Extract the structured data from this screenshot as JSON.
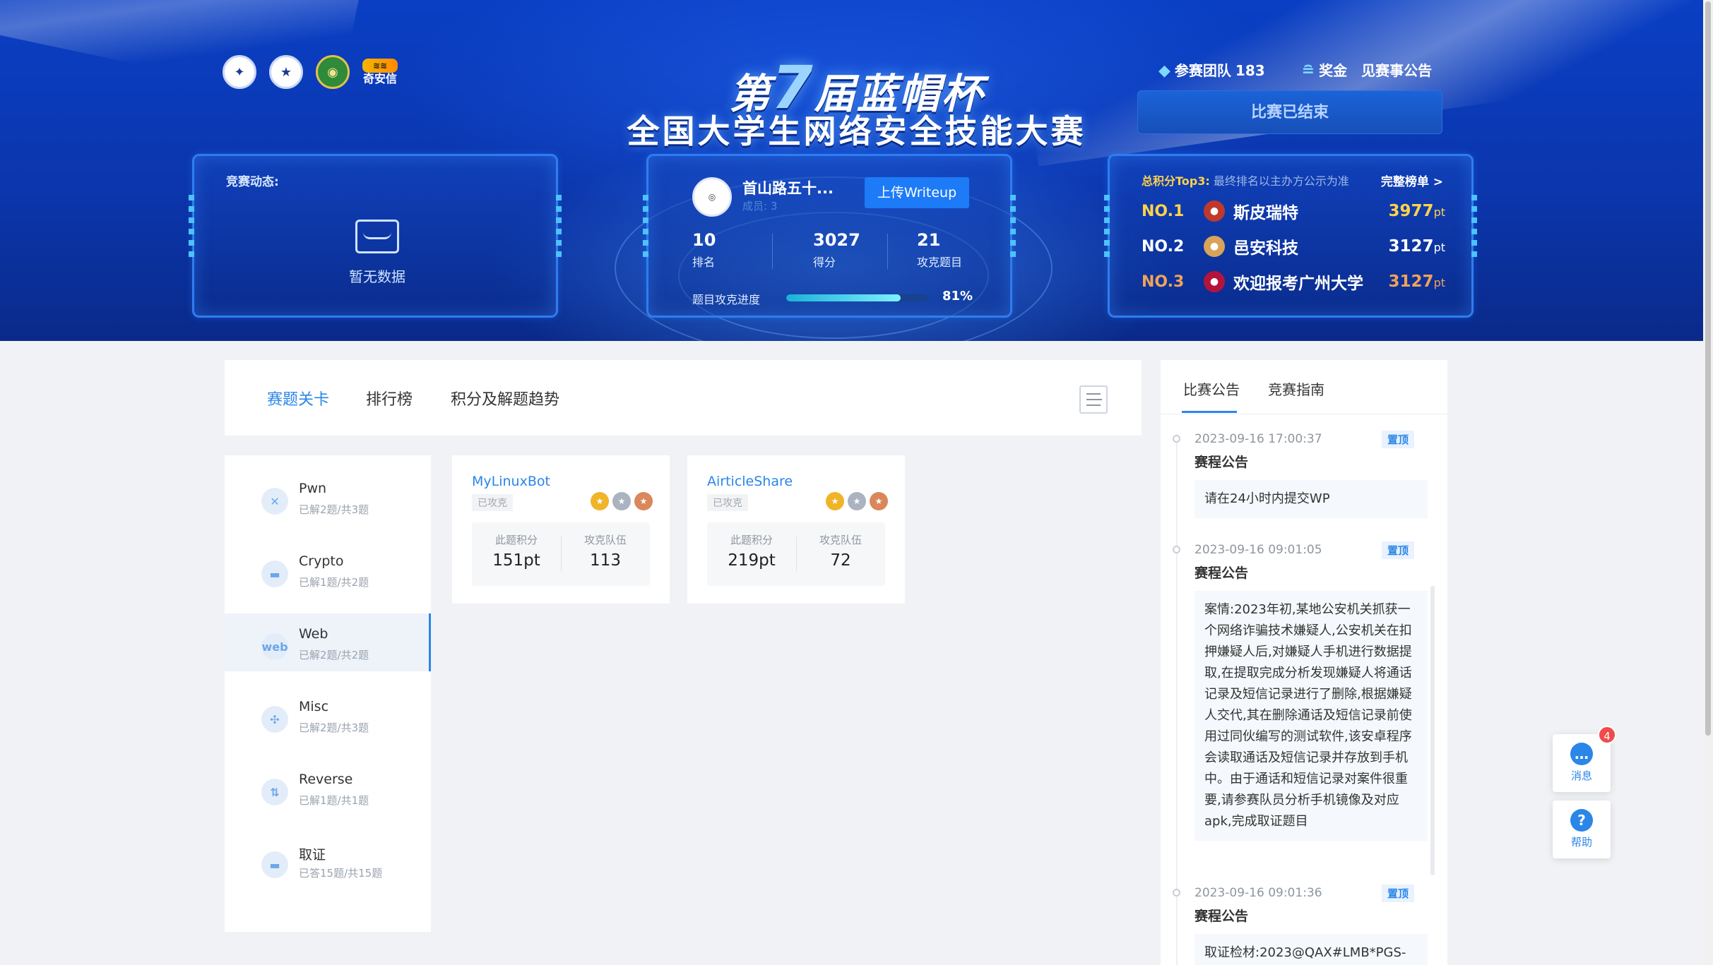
{
  "hero": {
    "logos": [
      "school-emblem-1",
      "school-emblem-2",
      "green-emblem",
      "qianxin-logo"
    ],
    "qax_label": "奇安信",
    "title_prefix": "第",
    "title_number": "7",
    "title_suffix": "届蓝帽杯",
    "subtitle": "全国大学生网络安全技能大赛",
    "teams_label": "参赛团队",
    "teams_count": "183",
    "prize_label": "奖金",
    "prize_value": "见赛事公告",
    "status_button": "比赛已结束"
  },
  "news_panel": {
    "title": "竞赛动态:",
    "empty_text": "暂无数据"
  },
  "team_panel": {
    "team_name": "首山路五十...",
    "members": "成员: 3",
    "upload_button": "上传Writeup",
    "rank_value": "10",
    "rank_label": "排名",
    "score_value": "3027",
    "score_label": "得分",
    "solved_value": "21",
    "solved_label": "攻克题目",
    "progress_label": "题目攻克进度",
    "progress_percent": "81%",
    "progress_fraction": 0.81
  },
  "top3_panel": {
    "title": "总积分Top3:",
    "note": "最终排名以主办方公示为准",
    "full_list": "完整榜单 >",
    "rows": [
      {
        "no": "NO.1",
        "team": "斯皮瑞特",
        "points": "3977",
        "unit": "pt",
        "color": "#ffd24a",
        "avatar_color": "#c0392b"
      },
      {
        "no": "NO.2",
        "team": "邑安科技",
        "points": "3127",
        "unit": "pt",
        "color": "#ffffff",
        "avatar_color": "#d8a45a"
      },
      {
        "no": "NO.3",
        "team": "欢迎报考广州大学",
        "points": "3127",
        "unit": "pt",
        "color": "#f0a25a",
        "avatar_color": "#b4143c"
      }
    ]
  },
  "tabs": {
    "items": [
      "赛题关卡",
      "排行榜",
      "积分及解题趋势"
    ],
    "active": "赛题关卡"
  },
  "categories": [
    {
      "name": "Pwn",
      "progress": "已解2题/共3题",
      "icon": "pwn-icon",
      "glyph": "✕"
    },
    {
      "name": "Crypto",
      "progress": "已解1题/共2题",
      "icon": "crypto-icon",
      "glyph": "▬"
    },
    {
      "name": "Web",
      "progress": "已解2题/共2题",
      "icon": "web-icon",
      "glyph": "web"
    },
    {
      "name": "Misc",
      "progress": "已解2题/共3题",
      "icon": "misc-icon",
      "glyph": "✣"
    },
    {
      "name": "Reverse",
      "progress": "已解1题/共1题",
      "icon": "reverse-icon",
      "glyph": "⇅"
    },
    {
      "name": "取证",
      "progress": "已答15题/共15题",
      "icon": "forensics-icon",
      "glyph": "▬"
    }
  ],
  "challenges": [
    {
      "title": "MyLinuxBot",
      "status": "已攻克",
      "score_label": "此题积分",
      "score": "151pt",
      "teams_label": "攻克队伍",
      "teams": "113"
    },
    {
      "title": "AirticleShare",
      "status": "已攻克",
      "score_label": "此题积分",
      "score": "219pt",
      "teams_label": "攻克队伍",
      "teams": "72"
    }
  ],
  "notices": {
    "tabs": [
      "比赛公告",
      "竞赛指南"
    ],
    "items": [
      {
        "time": "2023-09-16 17:00:37",
        "pin": "置顶",
        "title": "赛程公告",
        "body": "请在24小时内提交WP"
      },
      {
        "time": "2023-09-16 09:01:05",
        "pin": "置顶",
        "title": "赛程公告",
        "body": "案情:2023年初,某地公安机关抓获一个网络诈骗技术嫌疑人,公安机关在扣押嫌疑人后,对嫌疑人手机进行数据提取,在提取完成分析发现嫌疑人将通话记录及短信记录进行了删除,根据嫌疑人交代,其在删除通话及短信记录前使用过同伙编写的测试软件,该安卓程序会读取通话及短信记录并存放到手机中。由于通话和短信记录对案件很重要,请参赛队员分析手机镜像及对应apk,完成取证题目"
      },
      {
        "time": "2023-09-16 09:01:36",
        "pin": "置顶",
        "title": "赛程公告",
        "body": "取证检材:2023@QAX#LMB*PGS-"
      }
    ]
  },
  "float": {
    "message_label": "消息",
    "message_badge": "4",
    "help_label": "帮助"
  }
}
